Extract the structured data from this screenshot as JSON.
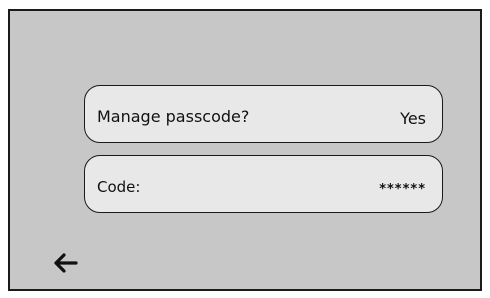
{
  "settings": {
    "manage_passcode": {
      "label": "Manage passcode?",
      "value": "Yes"
    },
    "code": {
      "label": "Code:",
      "value": "******"
    }
  },
  "navigation": {
    "back_icon": "left-arrow-icon"
  },
  "colors": {
    "screen_background": "#c7c7c7",
    "row_background": "#e8e8e8",
    "outline": "#1a1a1a"
  }
}
